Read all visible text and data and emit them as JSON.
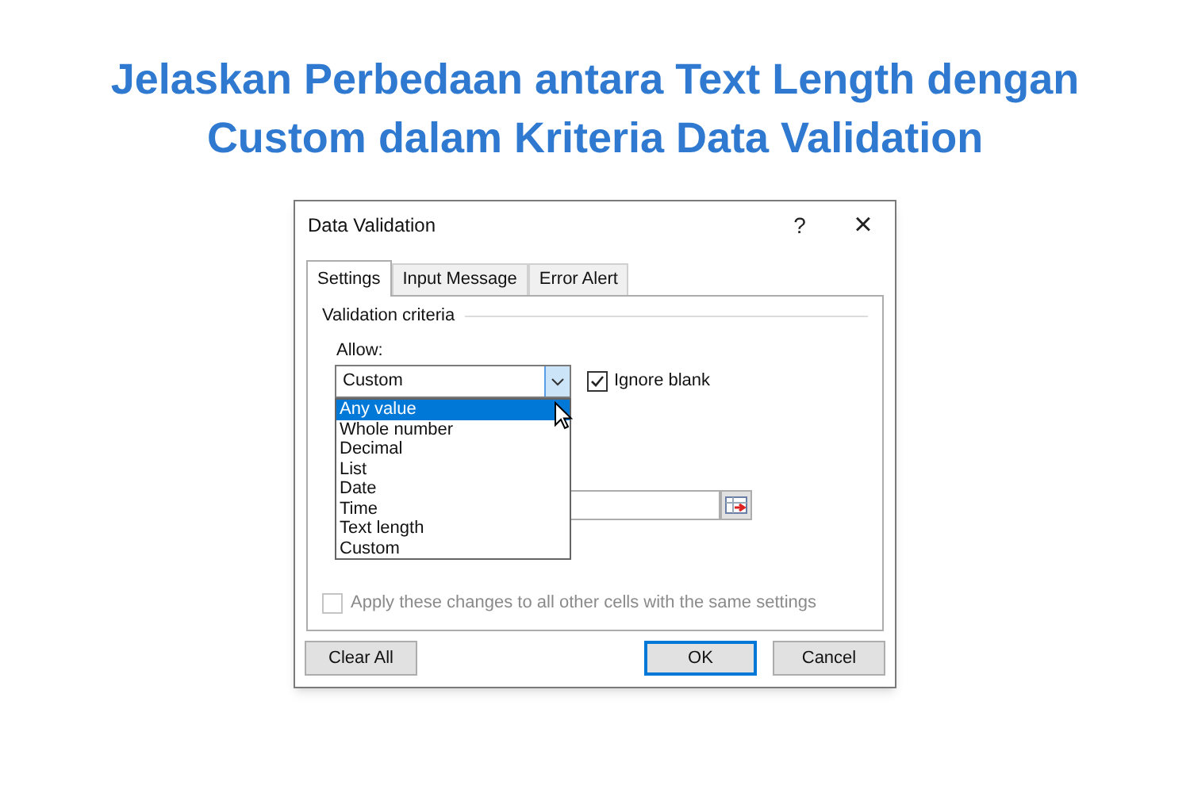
{
  "headline": [
    "Jelaskan Perbedaan antara Text Length dengan",
    "Custom dalam Kriteria Data Validation"
  ],
  "dialog": {
    "title": "Data Validation",
    "help": "?",
    "close": "×",
    "tabs": [
      {
        "label": "Settings",
        "selected": true
      },
      {
        "label": "Input Message",
        "selected": false
      },
      {
        "label": "Error Alert",
        "selected": false
      }
    ],
    "group_label": "Validation criteria",
    "allow_label": "Allow:",
    "allow_value": "Custom",
    "ignore_blank": {
      "label": "Ignore blank",
      "checked": true
    },
    "dropdown_options": [
      {
        "label": "Any value",
        "selected": true
      },
      {
        "label": "Whole number",
        "selected": false
      },
      {
        "label": "Decimal",
        "selected": false
      },
      {
        "label": "List",
        "selected": false
      },
      {
        "label": "Date",
        "selected": false
      },
      {
        "label": "Time",
        "selected": false
      },
      {
        "label": "Text length",
        "selected": false
      },
      {
        "label": "Custom",
        "selected": false
      }
    ],
    "apply_all": {
      "label": "Apply these changes to all other cells with the same settings",
      "checked": false,
      "disabled": true
    },
    "buttons": [
      {
        "label": "Clear All",
        "default": false
      },
      {
        "label": "OK",
        "default": true
      },
      {
        "label": "Cancel",
        "default": false
      }
    ]
  }
}
